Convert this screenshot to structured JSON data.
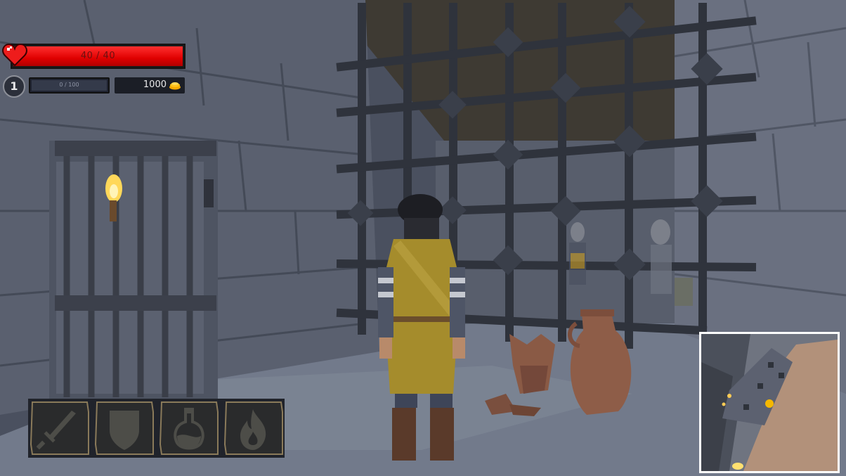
{
  "hud": {
    "health": {
      "current": 40,
      "max": 40,
      "text": "40 / 40",
      "fill_fraction": 1.0
    },
    "level": "1",
    "experience": {
      "text": "0 / 100",
      "fill_fraction": 0.0
    },
    "gold": "1000"
  },
  "skill_slots": [
    {
      "name": "sword",
      "icon": "sword-icon"
    },
    {
      "name": "shield",
      "icon": "shield-icon"
    },
    {
      "name": "potion",
      "icon": "potion-icon"
    },
    {
      "name": "fire",
      "icon": "fire-icon"
    }
  ],
  "colors": {
    "health": "#e00000",
    "slot_border": "#8a7a5a",
    "minimap_border": "#ffffff",
    "coin": "#f5a800"
  }
}
